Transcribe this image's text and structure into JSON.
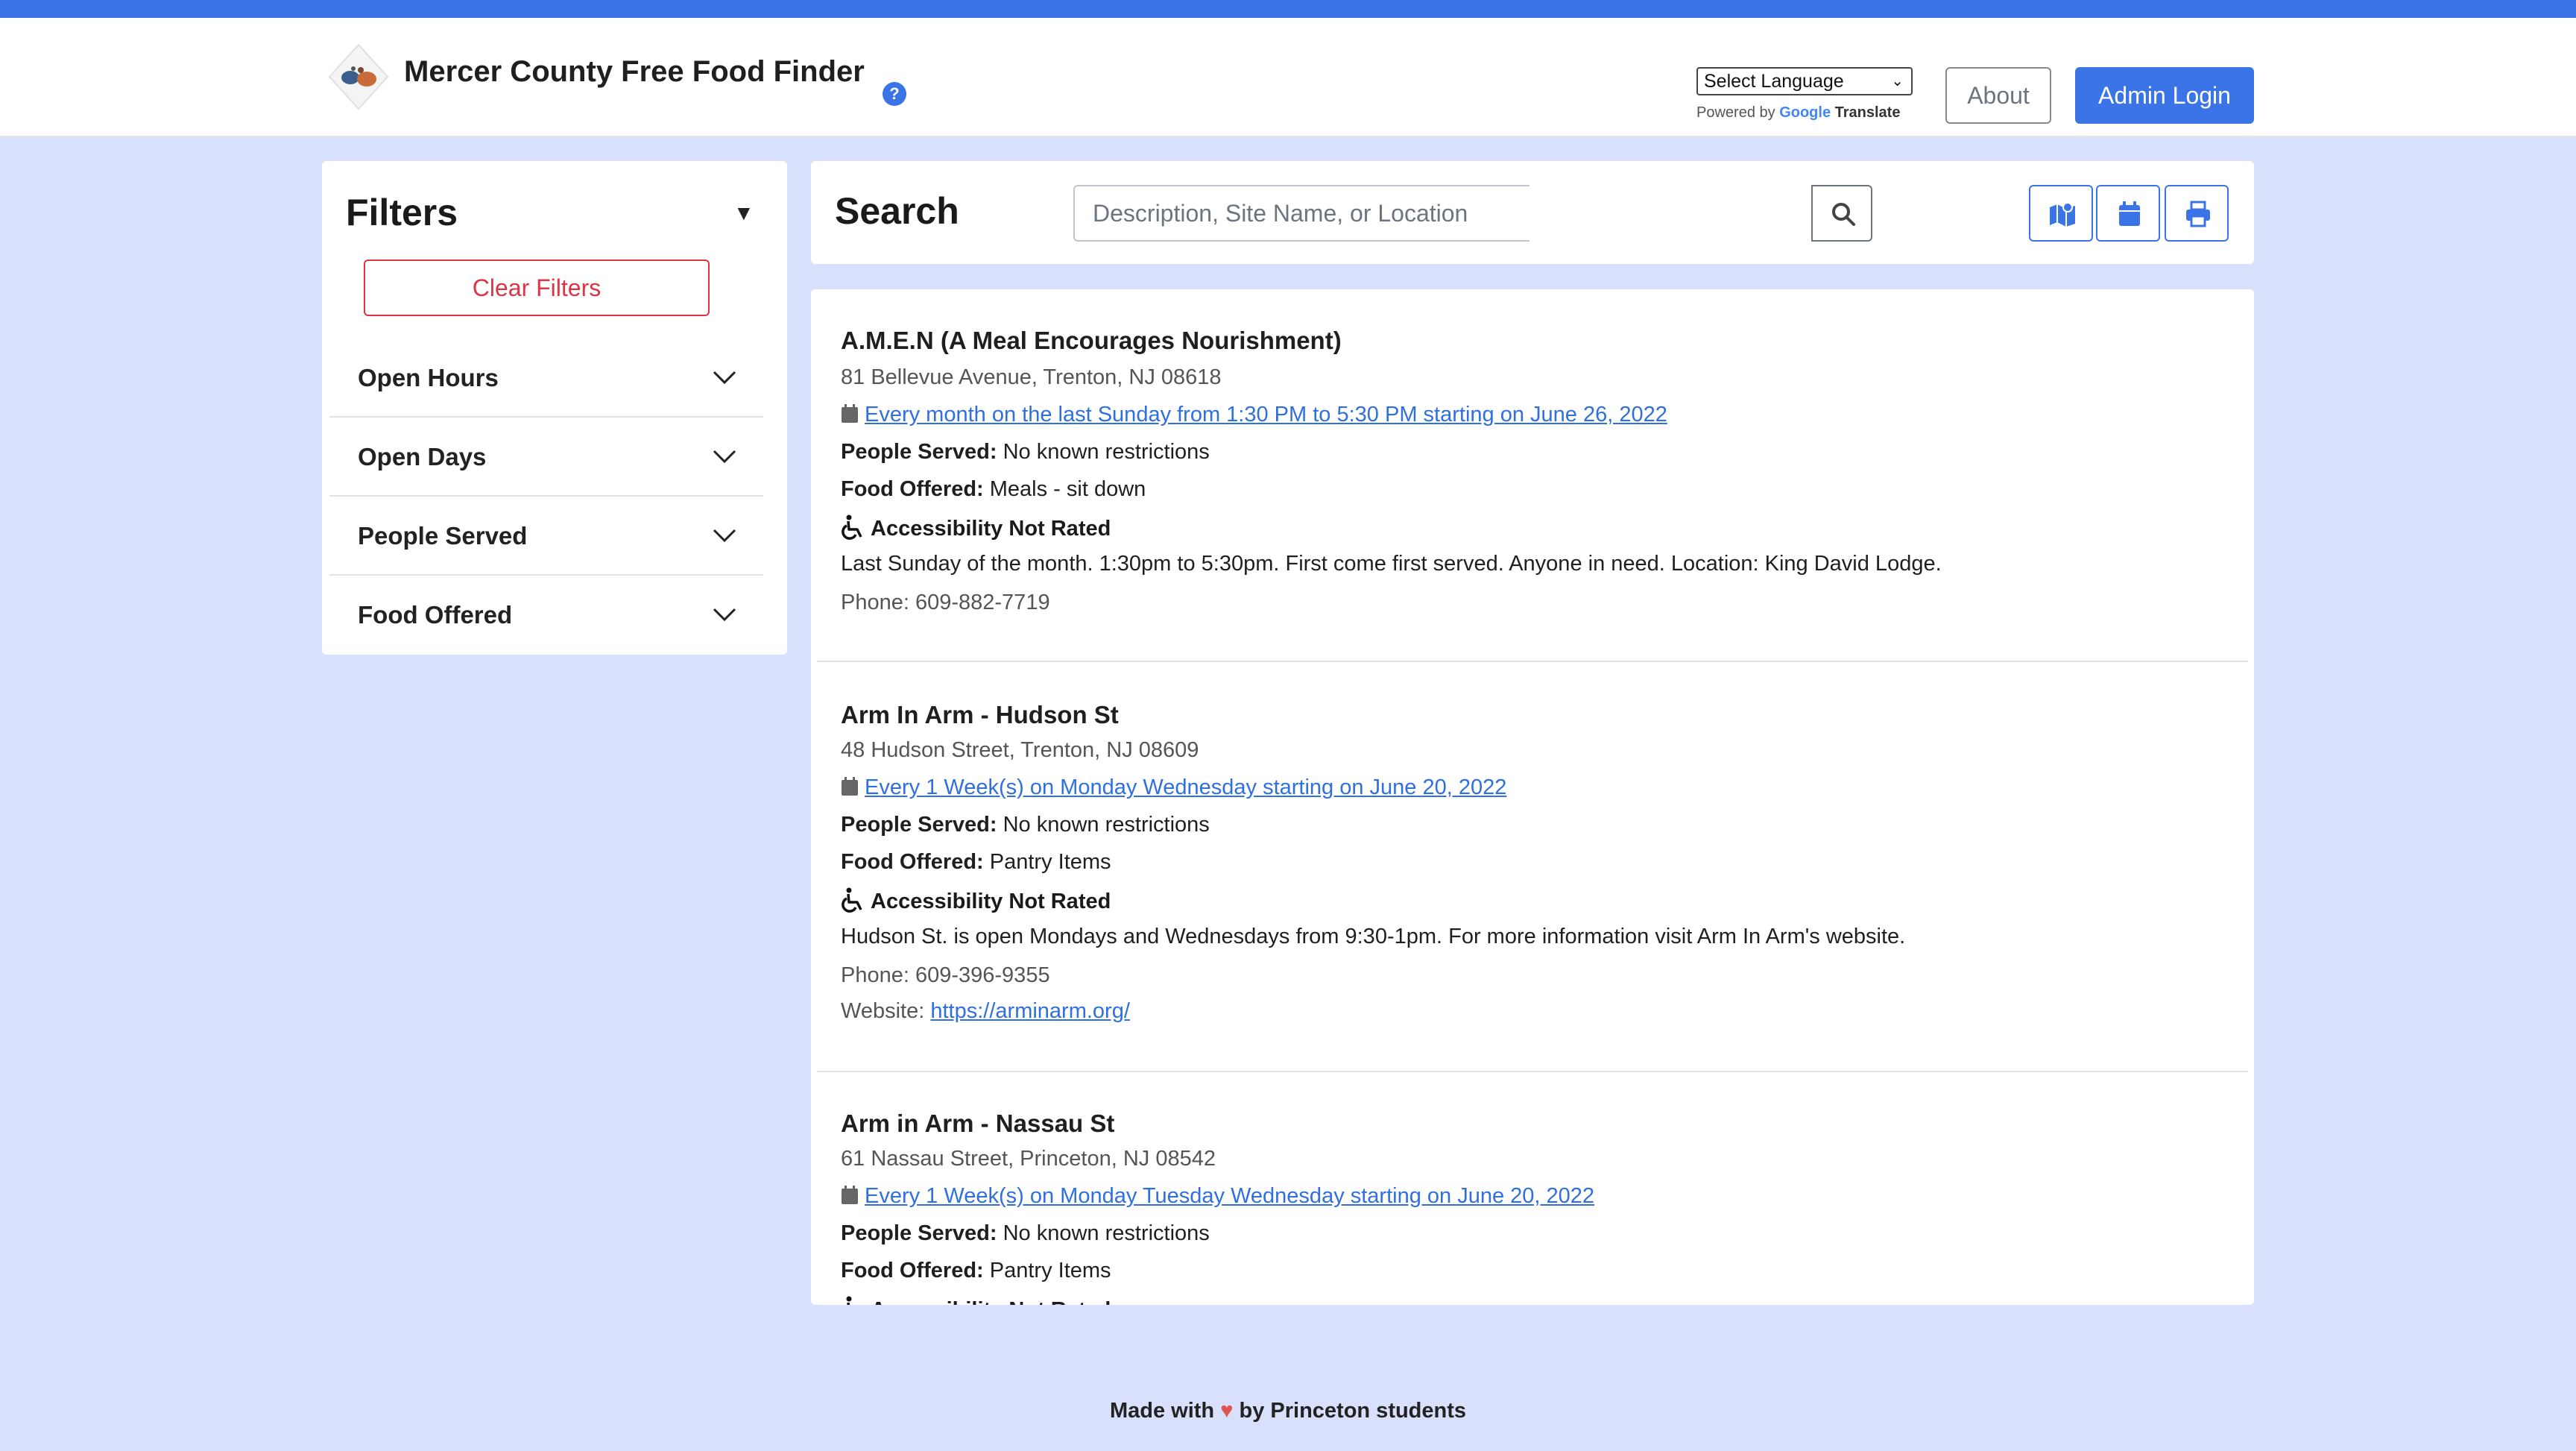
{
  "header": {
    "title": "Mercer County Free Food Finder",
    "help_glyph": "?",
    "language_select": "Select Language",
    "powered_by": "Powered by",
    "google": "Google",
    "translate": "Translate",
    "about_label": "About",
    "admin_label": "Admin Login"
  },
  "filters": {
    "title": "Filters",
    "clear_label": "Clear Filters",
    "groups": [
      {
        "label": "Open Hours"
      },
      {
        "label": "Open Days"
      },
      {
        "label": "People Served"
      },
      {
        "label": "Food Offered"
      }
    ]
  },
  "search": {
    "title": "Search",
    "placeholder": "Description, Site Name, or Location"
  },
  "results": [
    {
      "name": "A.M.E.N (A Meal Encourages Nourishment)",
      "address": "81 Bellevue Avenue, Trenton, NJ 08618",
      "schedule": "Every month on the last Sunday from 1:30 PM to 5:30 PM starting on June 26, 2022",
      "people_label": "People Served:",
      "people": "No known restrictions",
      "food_label": "Food Offered:",
      "food": "Meals - sit down",
      "accessibility": "Accessibility Not Rated",
      "description": "Last Sunday of the month. 1:30pm to 5:30pm. First come first served. Anyone in need. Location: King David Lodge.",
      "phone": "Phone: 609-882-7719"
    },
    {
      "name": "Arm In Arm - Hudson St",
      "address": "48 Hudson Street, Trenton, NJ 08609",
      "schedule": "Every 1 Week(s) on Monday Wednesday starting on June 20, 2022",
      "people_label": "People Served:",
      "people": "No known restrictions",
      "food_label": "Food Offered:",
      "food": "Pantry Items",
      "accessibility": "Accessibility Not Rated",
      "description": "Hudson St. is open Mondays and Wednesdays from 9:30-1pm. For more information visit Arm In Arm's website.",
      "phone": "Phone: 609-396-9355",
      "website_label": "Website:",
      "website": "https://arminarm.org/"
    },
    {
      "name": "Arm in Arm - Nassau St",
      "address": "61 Nassau Street, Princeton, NJ 08542",
      "schedule": "Every 1 Week(s) on Monday Tuesday Wednesday starting on June 20, 2022",
      "people_label": "People Served:",
      "people": "No known restrictions",
      "food_label": "Food Offered:",
      "food": "Pantry Items",
      "accessibility": "Accessibility Not Rated"
    }
  ],
  "footer": {
    "made_with": "Made with",
    "heart": "♥",
    "by": "by Princeton students"
  },
  "colors": {
    "accent": "#3b74e6",
    "danger": "#dc3545",
    "background": "#d8e0fb",
    "link": "#2f6fde"
  },
  "icons": [
    "help-icon",
    "chevron-down-icon",
    "search-icon",
    "map-icon",
    "calendar-icon",
    "printer-icon",
    "wheelchair-icon",
    "heart-icon"
  ]
}
